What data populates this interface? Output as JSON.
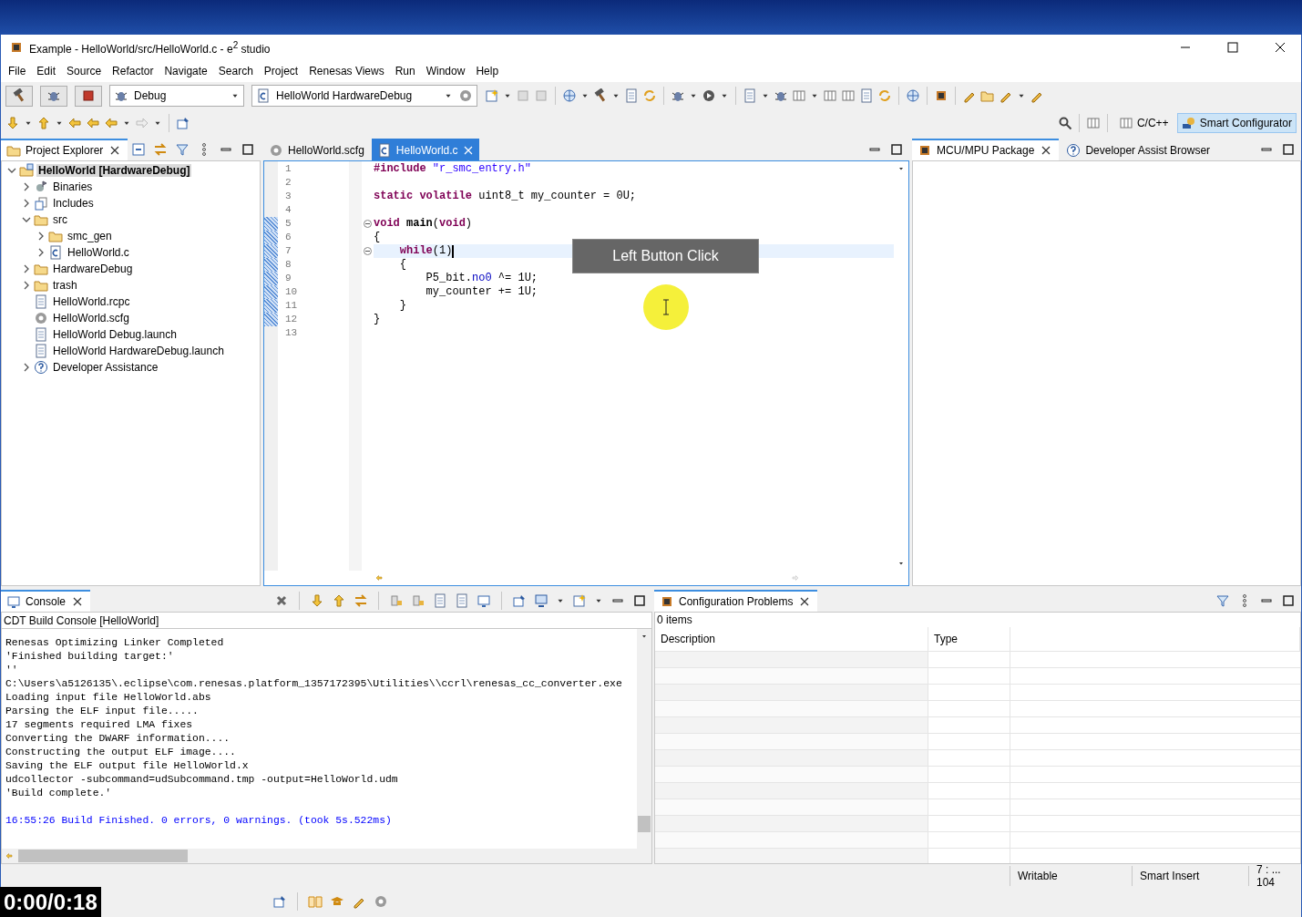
{
  "window": {
    "title": "Example - HelloWorld/src/HelloWorld.c - e$^{2}$ studio"
  },
  "menu": [
    "File",
    "Edit",
    "Source",
    "Refactor",
    "Navigate",
    "Search",
    "Project",
    "Renesas Views",
    "Run",
    "Window",
    "Help"
  ],
  "toolbar": {
    "launch_mode": "Debug",
    "launch_config": "HelloWorld HardwareDebug"
  },
  "perspectives": [
    {
      "label": "C/C++",
      "selected": false
    },
    {
      "label": "Smart Configurator",
      "selected": true
    }
  ],
  "project_explorer": {
    "title": "Project Explorer",
    "items": [
      {
        "label": "HelloWorld [HardwareDebug]",
        "kind": "project",
        "expanded": true,
        "selected": true,
        "children": [
          {
            "label": "Binaries",
            "kind": "binaries",
            "expanded": false
          },
          {
            "label": "Includes",
            "kind": "includes",
            "expanded": false
          },
          {
            "label": "src",
            "kind": "folder",
            "expanded": true,
            "children": [
              {
                "label": "smc_gen",
                "kind": "folder",
                "expanded": false
              },
              {
                "label": "HelloWorld.c",
                "kind": "cfile",
                "expanded": false
              }
            ]
          },
          {
            "label": "HardwareDebug",
            "kind": "folder",
            "expanded": false
          },
          {
            "label": "trash",
            "kind": "folder",
            "expanded": false
          },
          {
            "label": "HelloWorld.rcpc",
            "kind": "file"
          },
          {
            "label": "HelloWorld.scfg",
            "kind": "gear"
          },
          {
            "label": "HelloWorld Debug.launch",
            "kind": "file"
          },
          {
            "label": "HelloWorld HardwareDebug.launch",
            "kind": "file"
          },
          {
            "label": "Developer Assistance",
            "kind": "help",
            "expanded": false
          }
        ]
      }
    ]
  },
  "editor": {
    "tabs": [
      {
        "label": "HelloWorld.scfg",
        "kind": "gear",
        "selected": false
      },
      {
        "label": "HelloWorld.c",
        "kind": "cfile",
        "selected": true
      }
    ],
    "lines": [
      {
        "number": "1",
        "tokens": [
          {
            "kind": "keyword",
            "text": "#include "
          },
          {
            "kind": "string",
            "text": "\"r_smc_entry.h\""
          }
        ]
      },
      {
        "number": "2"
      },
      {
        "number": "3",
        "tokens": [
          {
            "kind": "keyword",
            "text": "static volatile"
          },
          {
            "kind": "plain",
            "text": " uint8_t my_counter = 0U;"
          }
        ]
      },
      {
        "number": "4"
      },
      {
        "number": "5",
        "changed": true,
        "collapsed": false,
        "tokens": [
          {
            "kind": "keyword",
            "text": "void"
          },
          {
            "kind": "function",
            "text": " main"
          },
          {
            "kind": "plain",
            "text": "("
          },
          {
            "kind": "keyword",
            "text": "void"
          },
          {
            "kind": "plain",
            "text": ")"
          }
        ]
      },
      {
        "number": "6",
        "changed": true,
        "tokens": [
          {
            "kind": "plain",
            "text": "{"
          }
        ]
      },
      {
        "number": "7",
        "changed": true,
        "current": true,
        "collapsed": false,
        "tokens": [
          {
            "kind": "keyword",
            "text": "    while"
          },
          {
            "kind": "plain",
            "text": "(1)"
          }
        ]
      },
      {
        "number": "8",
        "changed": true,
        "tokens": [
          {
            "kind": "plain",
            "text": "    {"
          }
        ]
      },
      {
        "number": "9",
        "changed": true,
        "tokens": [
          {
            "kind": "plain",
            "text": "        P5_bit."
          },
          {
            "kind": "field",
            "text": "no0"
          },
          {
            "kind": "plain",
            "text": " ^= 1U;"
          }
        ]
      },
      {
        "number": "10",
        "changed": true,
        "tokens": [
          {
            "kind": "plain",
            "text": "        my_counter += 1U;"
          }
        ]
      },
      {
        "number": "11",
        "changed": true,
        "tokens": [
          {
            "kind": "plain",
            "text": "    }"
          }
        ]
      },
      {
        "number": "12",
        "changed": true,
        "tokens": [
          {
            "kind": "plain",
            "text": "}"
          }
        ]
      },
      {
        "number": "13"
      }
    ]
  },
  "right_panel": {
    "tabs": [
      {
        "label": "MCU/MPU Package",
        "kind": "chip",
        "selected": true
      },
      {
        "label": "Developer Assist Browser",
        "kind": "help",
        "selected": false
      }
    ]
  },
  "console": {
    "title": "Console",
    "subtitle": "CDT Build Console [HelloWorld]",
    "lines": [
      {
        "kind": "output",
        "text": "Renesas Optimizing Linker Completed"
      },
      {
        "kind": "output",
        "text": "'Finished building target:'"
      },
      {
        "kind": "output",
        "text": "''"
      },
      {
        "kind": "output",
        "text": "C:\\Users\\a5126135\\.eclipse\\com.renesas.platform_1357172395\\Utilities\\\\ccrl\\renesas_cc_converter.exe"
      },
      {
        "kind": "output",
        "text": "Loading input file HelloWorld.abs"
      },
      {
        "kind": "output",
        "text": "Parsing the ELF input file....."
      },
      {
        "kind": "output",
        "text": "17 segments required LMA fixes"
      },
      {
        "kind": "output",
        "text": "Converting the DWARF information...."
      },
      {
        "kind": "output",
        "text": "Constructing the output ELF image...."
      },
      {
        "kind": "output",
        "text": "Saving the ELF output file HelloWorld.x"
      },
      {
        "kind": "output",
        "text": "udcollector -subcommand=udSubcommand.tmp -output=HelloWorld.udm"
      },
      {
        "kind": "output",
        "text": "'Build complete.'"
      },
      {
        "kind": "blank"
      },
      {
        "kind": "info",
        "text": "16:55:26 Build Finished. 0 errors, 0 warnings. (took 5s.522ms)"
      }
    ]
  },
  "problems": {
    "title": "Configuration Problems",
    "count": "0 items",
    "columns": [
      "Description",
      "Type"
    ]
  },
  "status_bar": [
    "Writable",
    "Smart Insert",
    "7 : ... 104"
  ],
  "overlay": {
    "click_label": "Left Button Click",
    "video_time": "0:00/0:18"
  }
}
